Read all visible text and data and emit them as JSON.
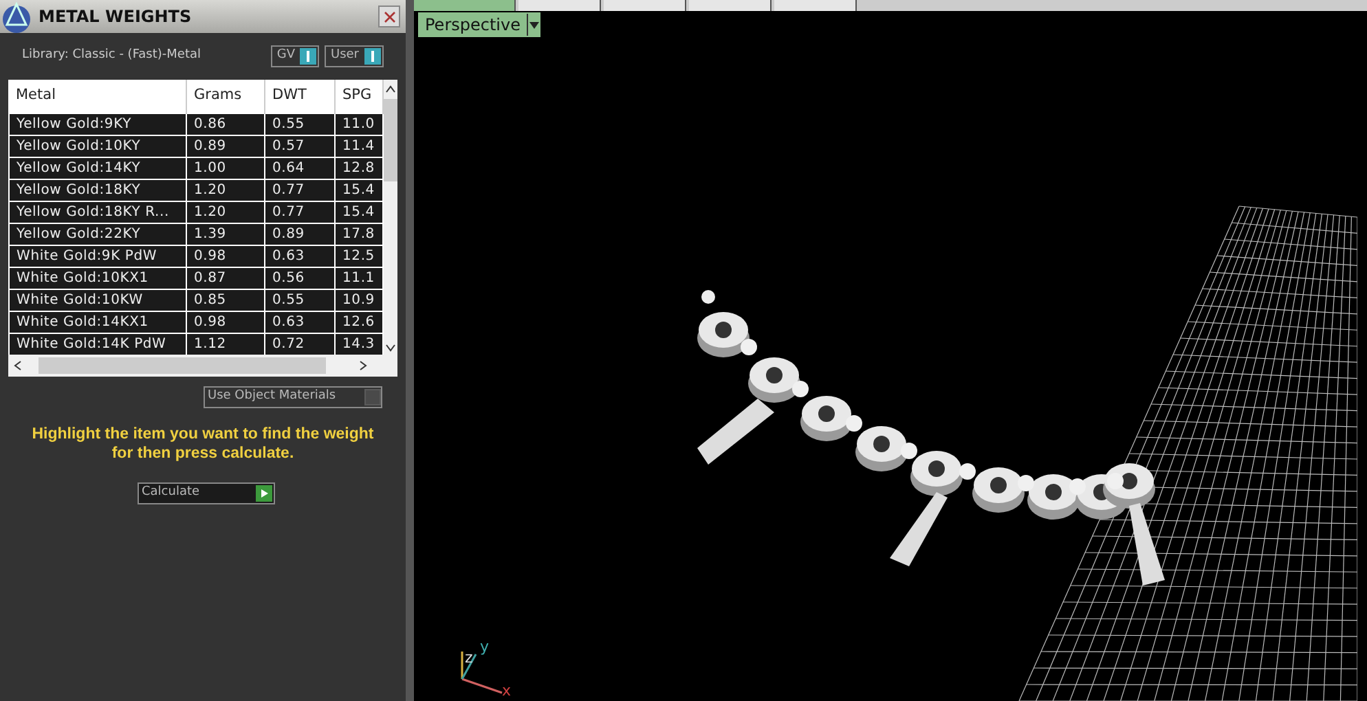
{
  "panel": {
    "title": "METAL WEIGHTS",
    "library": "Library: Classic - (Fast)-Metal",
    "toggles": [
      {
        "label": "GV",
        "on": true
      },
      {
        "label": "User",
        "on": true
      }
    ],
    "table": {
      "columns": [
        "Metal",
        "Grams",
        "DWT",
        "SPG"
      ],
      "rows": [
        [
          "Yellow Gold:9KY",
          "0.86",
          "0.55",
          "11.0"
        ],
        [
          "Yellow Gold:10KY",
          "0.89",
          "0.57",
          "11.4"
        ],
        [
          "Yellow Gold:14KY",
          "1.00",
          "0.64",
          "12.8"
        ],
        [
          "Yellow Gold:18KY",
          "1.20",
          "0.77",
          "15.4"
        ],
        [
          "Yellow Gold:18KY R...",
          "1.20",
          "0.77",
          "15.4"
        ],
        [
          "Yellow Gold:22KY",
          "1.39",
          "0.89",
          "17.8"
        ],
        [
          "White Gold:9K PdW",
          "0.98",
          "0.63",
          "12.5"
        ],
        [
          "White Gold:10KX1",
          "0.87",
          "0.56",
          "11.1"
        ],
        [
          "White Gold:10KW",
          "0.85",
          "0.55",
          "10.9"
        ],
        [
          "White Gold:14KX1",
          "0.98",
          "0.63",
          "12.6"
        ],
        [
          "White Gold:14K PdW",
          "1.12",
          "0.72",
          "14.3"
        ]
      ]
    },
    "use_object_materials": {
      "label": "Use Object Materials",
      "checked": false
    },
    "hint": "Highlight the item you want to find the weight for then press calculate.",
    "calculate_button": "Calculate"
  },
  "viewport": {
    "tabs": [
      {
        "selected": true
      },
      {
        "selected": false
      },
      {
        "selected": false
      },
      {
        "selected": false
      },
      {
        "selected": false
      }
    ],
    "view_dropdown": "Perspective",
    "axes": [
      "x",
      "y",
      "z"
    ]
  }
}
